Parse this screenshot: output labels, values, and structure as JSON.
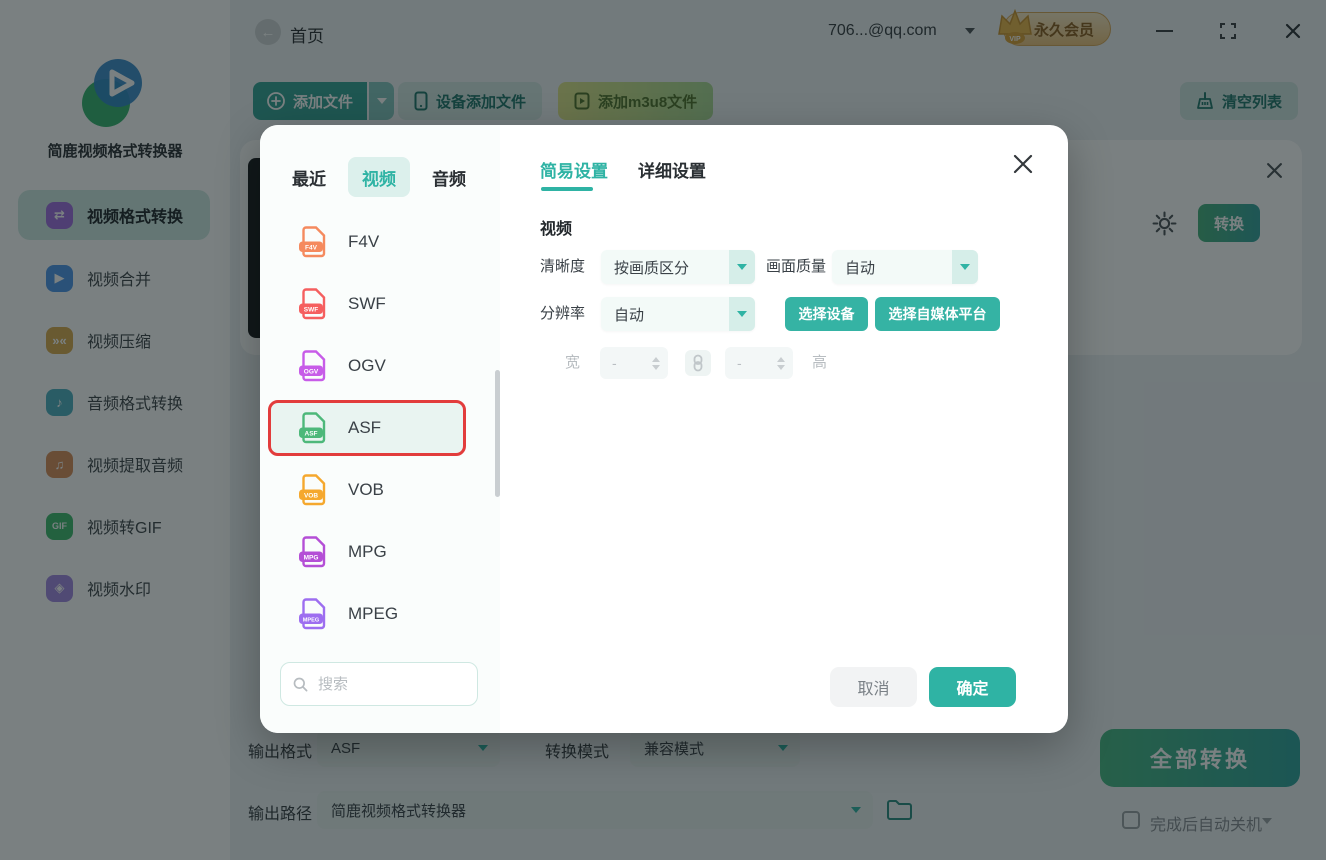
{
  "colors": {
    "accent": "#2fb3a4",
    "selected_border": "#e23c3c",
    "vip_text": "#8a5d20"
  },
  "topbar": {
    "home": "首页",
    "account": "706...@qq.com",
    "vip_label": "永久会员",
    "vip_tag": "VIP"
  },
  "toolbar": {
    "add_file": "添加文件",
    "add_from_device": "设备添加文件",
    "add_m3u8": "添加m3u8文件",
    "clear_list": "清空列表"
  },
  "sidebar": {
    "app_name": "简鹿视频格式转换器",
    "items": [
      {
        "label": "视频格式转换",
        "glyph": "⇄",
        "color": "#a06ee0",
        "active": true
      },
      {
        "label": "视频合并",
        "glyph": "▶",
        "color": "#4e97ea"
      },
      {
        "label": "视频压缩",
        "glyph": "»«",
        "color": "#d9aa4e"
      },
      {
        "label": "音频格式转换",
        "glyph": "♪",
        "color": "#4fb0c2"
      },
      {
        "label": "视频提取音频",
        "glyph": "♫",
        "color": "#d98e5a"
      },
      {
        "label": "视频转GIF",
        "glyph": "GIF",
        "color": "#3fba6e"
      },
      {
        "label": "视频水印",
        "glyph": "◈",
        "color": "#a287e2"
      }
    ]
  },
  "file_row": {
    "convert_label": "转换"
  },
  "bottom": {
    "output_format_label": "输出格式",
    "output_format_value": "ASF",
    "convert_mode_label": "转换模式",
    "convert_mode_value": "兼容模式",
    "output_path_label": "输出路径",
    "output_path_value": "简鹿视频格式转换器",
    "convert_all_label": "全部转换",
    "shutdown_label": "完成后自动关机"
  },
  "modal": {
    "tabs": [
      {
        "label": "最近"
      },
      {
        "label": "视频",
        "active": true
      },
      {
        "label": "音频"
      }
    ],
    "formats": [
      {
        "name": "F4V",
        "color": "#f58a5e"
      },
      {
        "name": "SWF",
        "color": "#f55f5f"
      },
      {
        "name": "OGV",
        "color": "#c75ce8"
      },
      {
        "name": "ASF",
        "color": "#4db87a",
        "selected": true
      },
      {
        "name": "VOB",
        "color": "#f5a82e"
      },
      {
        "name": "MPG",
        "color": "#b44fd6"
      },
      {
        "name": "MPEG",
        "color": "#9d6ef0"
      }
    ],
    "search_placeholder": "搜索",
    "settings": {
      "tab_easy": "简易设置",
      "tab_detail": "详细设置",
      "section": "视频",
      "clarity_label": "清晰度",
      "clarity_value": "按画质区分",
      "quality_label": "画面质量",
      "quality_value": "自动",
      "resolution_label": "分辨率",
      "resolution_value": "自动",
      "select_device": "选择设备",
      "select_platform": "选择自媒体平台",
      "width_label": "宽",
      "width_value": "-",
      "height_label": "高",
      "height_value": "-",
      "cancel": "取消",
      "confirm": "确定"
    }
  }
}
